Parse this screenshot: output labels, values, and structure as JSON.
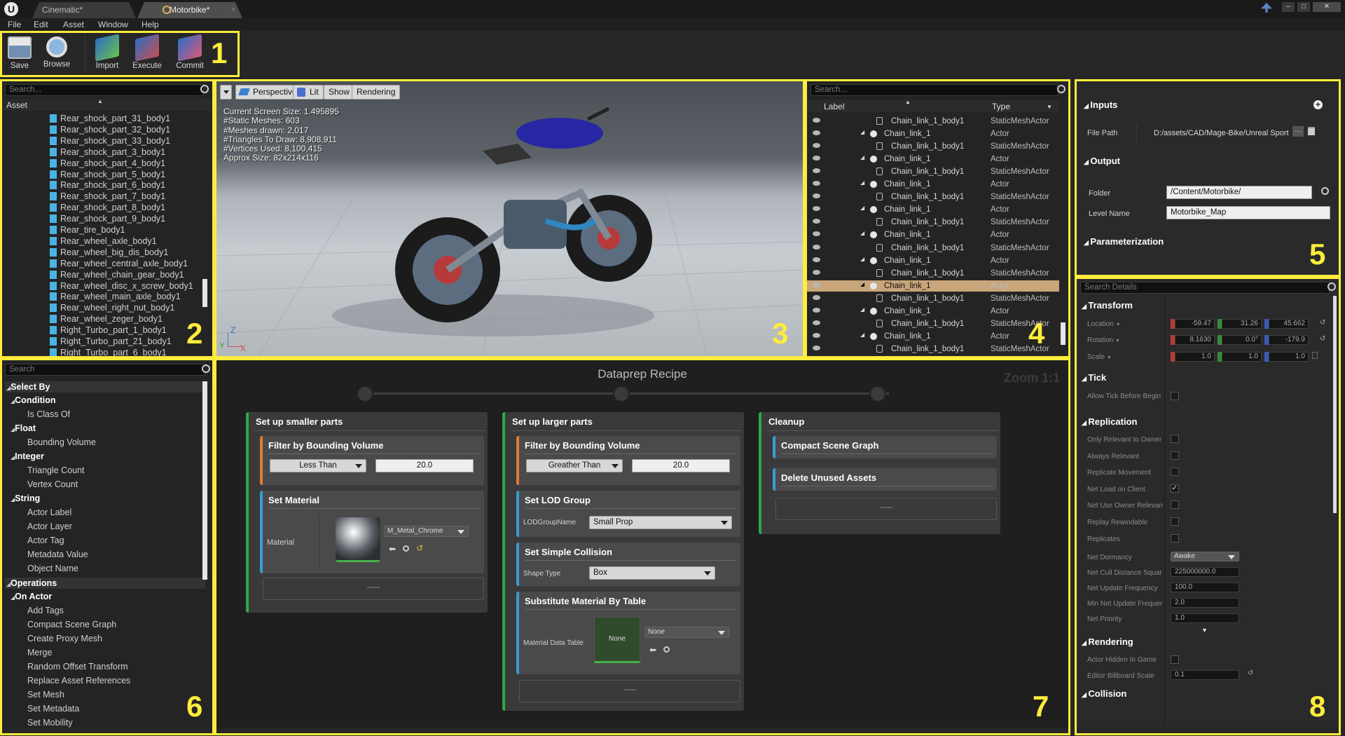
{
  "titlebar": {
    "tabs": [
      "Cinematic*",
      "Motorbike*"
    ]
  },
  "menu": [
    "File",
    "Edit",
    "Asset",
    "Window",
    "Help"
  ],
  "toolbar": {
    "save": "Save",
    "browse": "Browse",
    "import": "Import",
    "execute": "Execute",
    "commit": "Commit"
  },
  "callouts": [
    "1",
    "2",
    "3",
    "4",
    "5",
    "6",
    "7",
    "8"
  ],
  "assets": {
    "search": "Search...",
    "column": "Asset",
    "items": [
      "Rear_shock_part_31_body1",
      "Rear_shock_part_32_body1",
      "Rear_shock_part_33_body1",
      "Rear_shock_part_3_body1",
      "Rear_shock_part_4_body1",
      "Rear_shock_part_5_body1",
      "Rear_shock_part_6_body1",
      "Rear_shock_part_7_body1",
      "Rear_shock_part_8_body1",
      "Rear_shock_part_9_body1",
      "Rear_tire_body1",
      "Rear_wheel_axle_body1",
      "Rear_wheel_big_dis_body1",
      "Rear_wheel_central_axle_body1",
      "Rear_wheel_chain_gear_body1",
      "Rear_wheel_disc_x_screw_body1",
      "Rear_wheel_main_axle_body1",
      "Rear_wheel_right_nut_body1",
      "Rear_wheel_zeger_body1",
      "Right_Turbo_part_1_body1",
      "Right_Turbo_part_21_body1",
      "Right_Turbo_part_6_body1"
    ]
  },
  "viewport": {
    "buttons": [
      "Perspective",
      "Lit",
      "Show",
      "Rendering"
    ],
    "stats": [
      "Current Screen Size:  1.495895",
      "#Static Meshes:  603",
      "#Meshes drawn:  2,017",
      "#Triangles To Draw:  8,908,911",
      "#Vertices Used:  8,100,415",
      "Approx Size: 82x214x116"
    ],
    "axes": [
      "Z",
      "Y",
      "X"
    ]
  },
  "outliner": {
    "search": "Search...",
    "col_label": "Label",
    "col_type": "Type",
    "rows": [
      {
        "label": "Chain_link_1_body1",
        "type": "StaticMeshActor",
        "indent": 2
      },
      {
        "label": "Chain_link_1",
        "type": "Actor",
        "indent": 1
      },
      {
        "label": "Chain_link_1_body1",
        "type": "StaticMeshActor",
        "indent": 2
      },
      {
        "label": "Chain_link_1",
        "type": "Actor",
        "indent": 1
      },
      {
        "label": "Chain_link_1_body1",
        "type": "StaticMeshActor",
        "indent": 2
      },
      {
        "label": "Chain_link_1",
        "type": "Actor",
        "indent": 1
      },
      {
        "label": "Chain_link_1_body1",
        "type": "StaticMeshActor",
        "indent": 2
      },
      {
        "label": "Chain_link_1",
        "type": "Actor",
        "indent": 1
      },
      {
        "label": "Chain_link_1_body1",
        "type": "StaticMeshActor",
        "indent": 2
      },
      {
        "label": "Chain_link_1",
        "type": "Actor",
        "indent": 1
      },
      {
        "label": "Chain_link_1_body1",
        "type": "StaticMeshActor",
        "indent": 2
      },
      {
        "label": "Chain_link_1",
        "type": "Actor",
        "indent": 1
      },
      {
        "label": "Chain_link_1_body1",
        "type": "StaticMeshActor",
        "indent": 2
      },
      {
        "label": "Chain_link_1",
        "type": "Actor",
        "indent": 1,
        "selected": true
      },
      {
        "label": "Chain_link_1_body1",
        "type": "StaticMeshActor",
        "indent": 2
      },
      {
        "label": "Chain_link_1",
        "type": "Actor",
        "indent": 1
      },
      {
        "label": "Chain_link_1_body1",
        "type": "StaticMeshActor",
        "indent": 2
      },
      {
        "label": "Chain_link_1",
        "type": "Actor",
        "indent": 1
      },
      {
        "label": "Chain_link_1_body1",
        "type": "StaticMeshActor",
        "indent": 2
      }
    ]
  },
  "settings": {
    "inputs": "Inputs",
    "file_path_label": "File Path",
    "file_path": "D:/assets/CAD/Mage-Bike/Unreal Sport",
    "output": "Output",
    "folder_label": "Folder",
    "folder": "/Content/Motorbike/",
    "level_label": "Level Name",
    "level": "Motorbike_Map",
    "param": "Parameterization"
  },
  "palette": {
    "search": "Search",
    "items": [
      {
        "t": "Select By",
        "lvl": 0
      },
      {
        "t": "Condition",
        "lvl": 1
      },
      {
        "t": "Is Class Of",
        "lvl": 2
      },
      {
        "t": "Float",
        "lvl": 1
      },
      {
        "t": "Bounding Volume",
        "lvl": 2
      },
      {
        "t": "Integer",
        "lvl": 1
      },
      {
        "t": "Triangle Count",
        "lvl": 2
      },
      {
        "t": "Vertex Count",
        "lvl": 2
      },
      {
        "t": "String",
        "lvl": 1
      },
      {
        "t": "Actor Label",
        "lvl": 2
      },
      {
        "t": "Actor Layer",
        "lvl": 2
      },
      {
        "t": "Actor Tag",
        "lvl": 2
      },
      {
        "t": "Metadata Value",
        "lvl": 2
      },
      {
        "t": "Object Name",
        "lvl": 2
      },
      {
        "t": "Operations",
        "lvl": 0
      },
      {
        "t": "On Actor",
        "lvl": 1
      },
      {
        "t": "Add Tags",
        "lvl": 2
      },
      {
        "t": "Compact Scene Graph",
        "lvl": 2
      },
      {
        "t": "Create Proxy Mesh",
        "lvl": 2
      },
      {
        "t": "Merge",
        "lvl": 2
      },
      {
        "t": "Random Offset Transform",
        "lvl": 2
      },
      {
        "t": "Replace Asset References",
        "lvl": 2
      },
      {
        "t": "Set Mesh",
        "lvl": 2
      },
      {
        "t": "Set Metadata",
        "lvl": 2
      },
      {
        "t": "Set Mobility",
        "lvl": 2
      }
    ]
  },
  "recipe": {
    "title": "Dataprep Recipe",
    "zoom": "Zoom 1:1",
    "col1": {
      "title": "Set up smaller parts",
      "filter": "Filter by Bounding Volume",
      "op": "Less Than",
      "value": "20.0",
      "setmat": "Set Material",
      "mat_label": "Material",
      "mat": "M_Metal_Chrome",
      "empty": "-----"
    },
    "col2": {
      "title": "Set up larger parts",
      "filter": "Filter by Bounding Volume",
      "op": "Greather Than",
      "value": "20.0",
      "lod": "Set LOD Group",
      "lod_label": "LODGroupName",
      "lod_val": "Small Prop",
      "col": "Set Simple Collision",
      "shape_label": "Shape Type",
      "shape": "Box",
      "sub": "Substitute Material By Table",
      "table_label": "Material Data Table",
      "thumb": "None",
      "table": "None",
      "empty": "-----"
    },
    "col3": {
      "title": "Cleanup",
      "op1": "Compact Scene Graph",
      "op2": "Delete Unused Assets",
      "empty": "-----"
    }
  },
  "details": {
    "search": "Search Details",
    "transform": "Transform",
    "location": "Location",
    "rotation": "Rotation",
    "scale": "Scale",
    "loc": [
      "-59.47",
      "31.26",
      "45.662"
    ],
    "rot": [
      "8.1630",
      "0.0°",
      "-179.9"
    ],
    "scl": [
      "1.0",
      "1.0",
      "1.0"
    ],
    "tick": "Tick",
    "tick_opt": "Allow Tick Before Begin",
    "replication": "Replication",
    "rep": [
      "Only Relevant to Owner",
      "Always Relevant",
      "Replicate Movement",
      "Net Load on Client",
      "Net Use Owner Relevan",
      "Replay Rewindable",
      "Replicates"
    ],
    "dormancy_label": "Net Dormancy",
    "dormancy": "Awake",
    "cull_label": "Net Cull Distance Squar",
    "cull": "225000000.0",
    "freq_label": "Net Update Frequency",
    "freq": "100.0",
    "minfreq_label": "Min Net Update Frequer",
    "minfreq": "2.0",
    "prio_label": "Net Priority",
    "prio": "1.0",
    "rendering": "Rendering",
    "hidden": "Actor Hidden In Game",
    "billboard_label": "Editor Billboard Scale",
    "billboard": "0.1",
    "collision": "Collision"
  },
  "colors": {
    "frame": "#ffec3c",
    "selected": "#c8a57a",
    "file_icon": "#49b3e6",
    "green_bar": "#2ea84a",
    "orange_bar": "#e07b32",
    "blue_bar": "#3b9bd6"
  }
}
